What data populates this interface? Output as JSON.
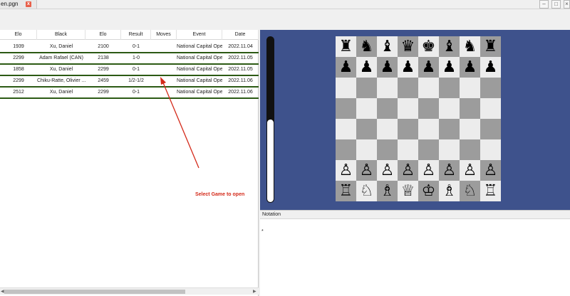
{
  "tab": {
    "title": "en.pgn",
    "close_glyph": "x"
  },
  "window_controls": {
    "minimize": "–",
    "maximize": "□",
    "close": "×"
  },
  "table": {
    "columns": [
      "Elo",
      "Black",
      "Elo",
      "Result",
      "Moves",
      "Event",
      "Date"
    ],
    "rows": [
      {
        "white_elo": "1939",
        "black": "Xu, Daniel",
        "black_elo": "2100",
        "result": "0-1",
        "moves": "",
        "event": "National Capital Open",
        "date": "2022.11.04"
      },
      {
        "white_elo": "2299",
        "black": "Adam Rafael (CAN)",
        "black_elo": "2138",
        "result": "1-0",
        "moves": "",
        "event": "National Capital Open",
        "date": "2022.11.05"
      },
      {
        "white_elo": "1858",
        "black": "Xu, Daniel",
        "black_elo": "2299",
        "result": "0-1",
        "moves": "",
        "event": "National Capital Open",
        "date": "2022.11.05"
      },
      {
        "white_elo": "2299",
        "black": "Chiku-Ratte, Olivier ...",
        "black_elo": "2459",
        "result": "1/2-1/2",
        "moves": "",
        "event": "National Capital Open",
        "date": "2022.11.06"
      },
      {
        "white_elo": "2512",
        "black": "Xu, Daniel",
        "black_elo": "2299",
        "result": "0-1",
        "moves": "",
        "event": "National Capital Open",
        "date": "2022.11.06"
      }
    ]
  },
  "annotation": {
    "text": "Select Game to open",
    "color": "#d42a1a"
  },
  "board": {
    "ranks": [
      [
        "♜",
        "♞",
        "♝",
        "♛",
        "♚",
        "♝",
        "♞",
        "♜"
      ],
      [
        "♟",
        "♟",
        "♟",
        "♟",
        "♟",
        "♟",
        "♟",
        "♟"
      ],
      [
        "",
        "",
        "",
        "",
        "",
        "",
        "",
        ""
      ],
      [
        "",
        "",
        "",
        "",
        "",
        "",
        "",
        ""
      ],
      [
        "",
        "",
        "",
        "",
        "",
        "",
        "",
        ""
      ],
      [
        "",
        "",
        "",
        "",
        "",
        "",
        "",
        ""
      ],
      [
        "♙",
        "♙",
        "♙",
        "♙",
        "♙",
        "♙",
        "♙",
        "♙"
      ],
      [
        "♖",
        "♘",
        "♗",
        "♕",
        "♔",
        "♗",
        "♘",
        "♖"
      ]
    ],
    "light_color": "#ececec",
    "dark_color": "#9c9c9c",
    "background_color": "#3e528c"
  },
  "eval_bar": {
    "white_fraction": 0.5
  },
  "notation": {
    "header": "Notation",
    "text": "*"
  }
}
